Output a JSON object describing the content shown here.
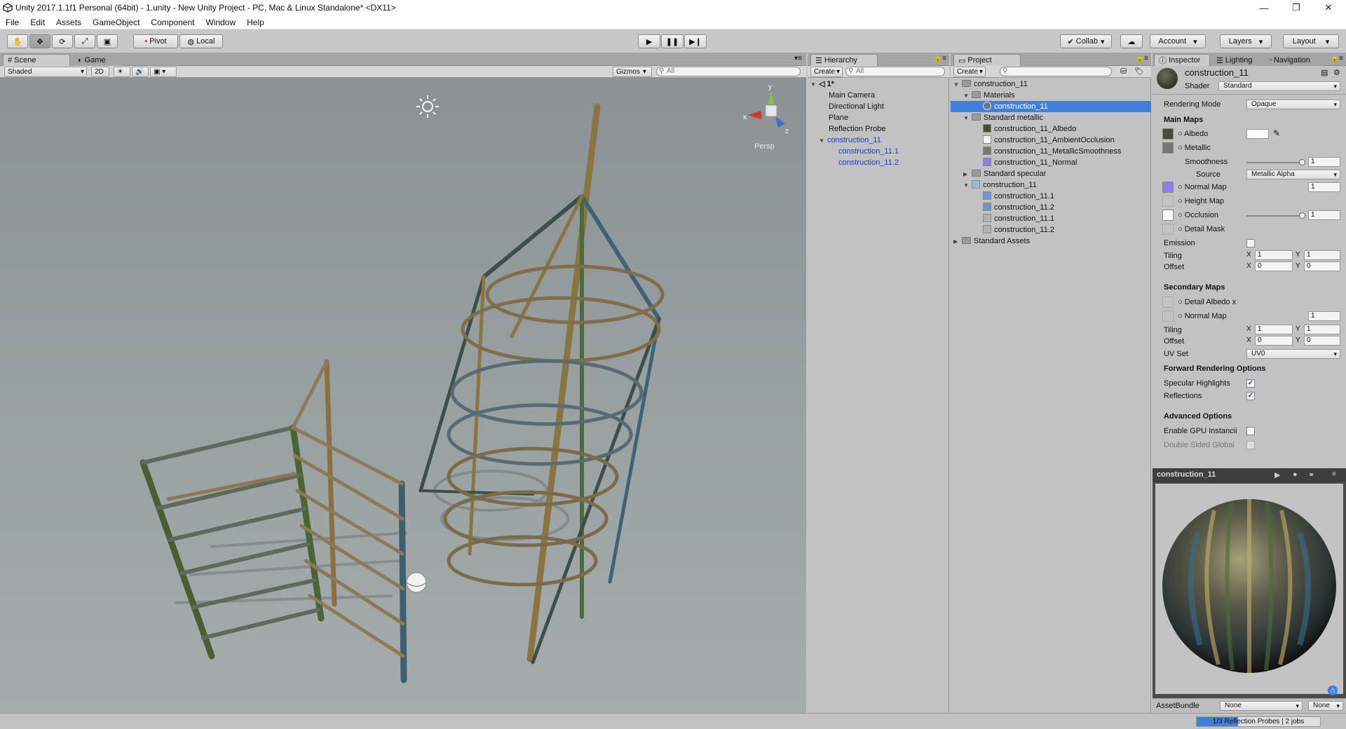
{
  "window": {
    "title": "Unity 2017.1.1f1 Personal (64bit) - 1.unity - New Unity Project - PC, Mac & Linux Standalone* <DX11>",
    "minimize": "—",
    "maximize": "❐",
    "close": "✕"
  },
  "menu": [
    "File",
    "Edit",
    "Assets",
    "GameObject",
    "Component",
    "Window",
    "Help"
  ],
  "toolbar": {
    "pivot": "Pivot",
    "local": "Local",
    "collab": "Collab",
    "account": "Account",
    "layers": "Layers",
    "layout": "Layout"
  },
  "scene": {
    "tab_scene": "Scene",
    "tab_game": "Game",
    "shading": "Shaded",
    "mode2d": "2D",
    "gizmos": "Gizmos",
    "search_placeholder": "All",
    "persp": "Persp",
    "axis_y": "y",
    "axis_x": "x",
    "axis_z": "z"
  },
  "hierarchy": {
    "tab": "Hierarchy",
    "create": "Create",
    "search_placeholder": "All",
    "scene_name": "1*",
    "items": [
      "Main Camera",
      "Directional Light",
      "Plane",
      "Reflection Probe",
      "construction_11",
      "construction_11.1",
      "construction_11.2"
    ]
  },
  "project": {
    "tab": "Project",
    "create": "Create",
    "items": [
      "construction_11",
      "Materials",
      "construction_11",
      "Standard metallic",
      "construction_11_Albedo",
      "construction_11_AmbientOcclusion",
      "construction_11_MetallicSmoothness",
      "construction_11_Normal",
      "Standard specular",
      "construction_11",
      "construction_11.1",
      "construction_11.2",
      "construction_11.1",
      "construction_11.2",
      "Standard Assets"
    ]
  },
  "inspector": {
    "tabs": [
      "Inspector",
      "Lighting",
      "Navigation"
    ],
    "object_name": "construction_11",
    "shader_label": "Shader",
    "shader_value": "Standard",
    "rendering_mode_label": "Rendering Mode",
    "rendering_mode": "Opaque",
    "main_maps": "Main Maps",
    "albedo": "Albedo",
    "metallic": "Metallic",
    "smoothness": "Smoothness",
    "smoothness_value": "1",
    "smoothness_level": 1.0,
    "source": "Source",
    "source_value": "Metallic Alpha",
    "normal_map": "Normal Map",
    "normal_value": "1",
    "height_map": "Height Map",
    "occlusion": "Occlusion",
    "occlusion_value": "1",
    "occlusion_level": 1.0,
    "detail_mask": "Detail Mask",
    "emission": "Emission",
    "tiling": "Tiling",
    "offset": "Offset",
    "x": "X",
    "y": "Y",
    "tiling_x": "1",
    "tiling_y": "1",
    "offset_x": "0",
    "offset_y": "0",
    "secondary_maps": "Secondary Maps",
    "detail_albedo": "Detail Albedo x",
    "sec_normal": "Normal Map",
    "sec_normal_value": "1",
    "sec_tiling_x": "1",
    "sec_tiling_y": "1",
    "sec_offset_x": "0",
    "sec_offset_y": "0",
    "uv_set": "UV Set",
    "uv_set_value": "UV0",
    "forward": "Forward Rendering Options",
    "specular": "Specular Highlights",
    "reflections": "Reflections",
    "check": "✓",
    "advanced": "Advanced Options",
    "gpu_instancing": "Enable GPU Instancii",
    "double_sided": "Double Sided Global"
  },
  "preview": {
    "title": "construction_11",
    "assetbundle": "AssetBundle",
    "none1": "None",
    "none2": "None"
  },
  "status": {
    "text": "1/3 Reflection Probes | 2 jobs"
  },
  "colors": {
    "selection": "#3d80df",
    "link_blue": "#1a3ec2",
    "panel": "#c2c2c2"
  }
}
